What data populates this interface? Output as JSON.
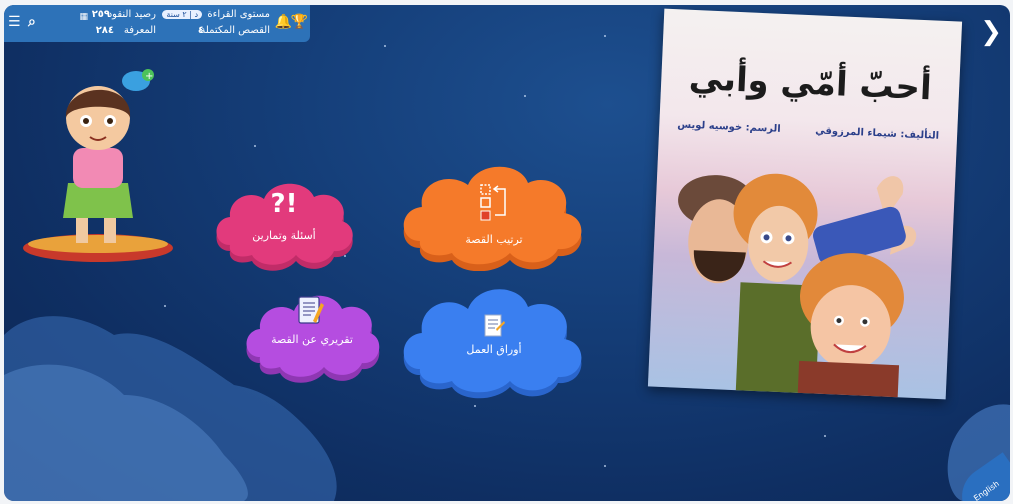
{
  "topbar": {
    "reading_level_label": "مستوى القراءة",
    "level_badge": "د | ٢ سنة",
    "coins_label": "رصيد النقود",
    "coins_value": "٢٥٩",
    "completed_label": "القصص المكتملة",
    "completed_value": "٤",
    "knowledge_label": "المعرفة",
    "knowledge_value": "٢٨٤"
  },
  "book": {
    "title": "أحبّ أمّي وأبي",
    "author": "التأليف: شيماء المرزوقي",
    "illustrator": "الرسم: خوسيه لويس"
  },
  "activities": {
    "questions": "أسئلة وتمارين",
    "order": "ترتيب القصة",
    "report": "تقريري عن القصة",
    "worksheets": "أوراق العمل"
  },
  "colors": {
    "pink": "#e23a7c",
    "orange": "#f57a2a",
    "purple": "#b54de0",
    "blue": "#3a7ff0"
  },
  "language": "English"
}
